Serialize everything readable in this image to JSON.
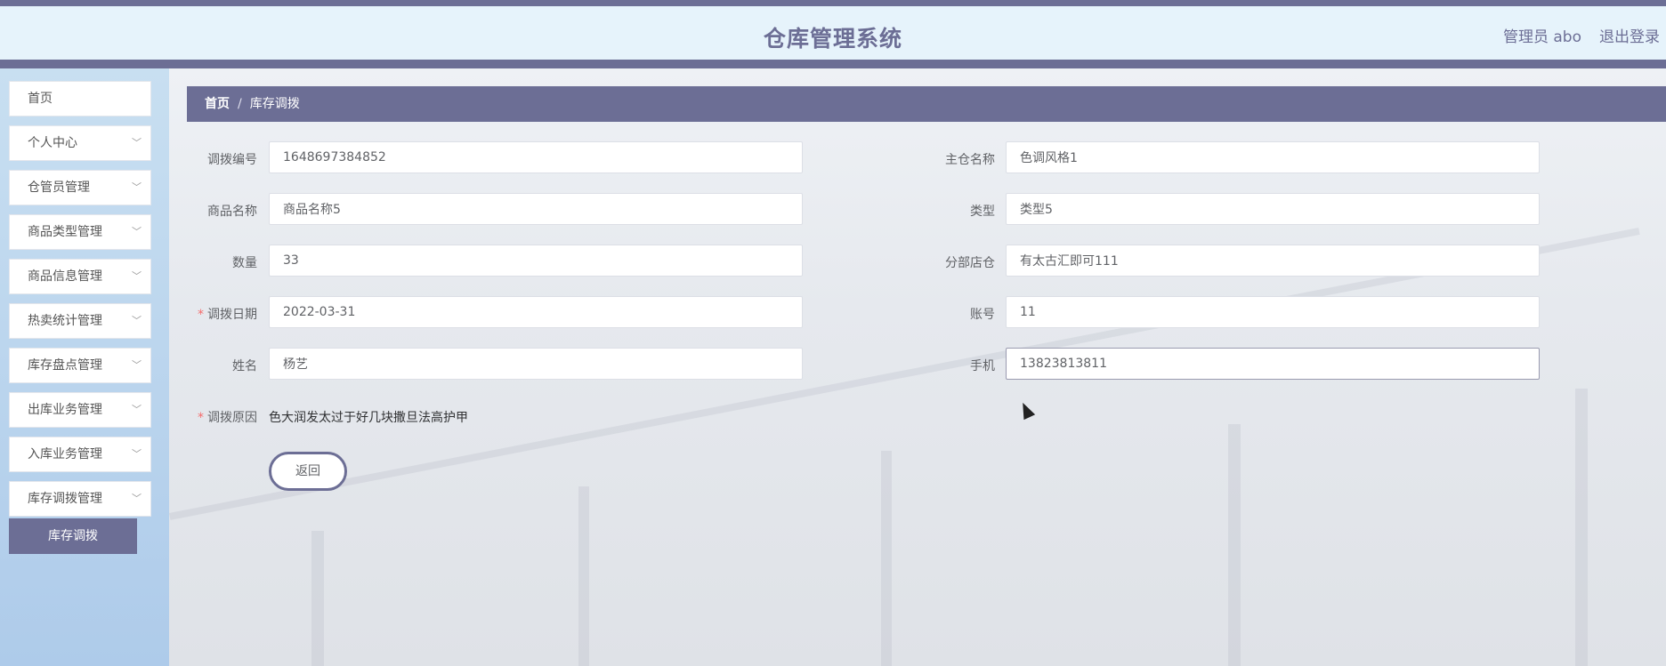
{
  "header": {
    "title": "仓库管理系统",
    "user": "管理员 abo",
    "logout": "退出登录"
  },
  "sidebar": {
    "items": [
      {
        "label": "首页",
        "expandable": false
      },
      {
        "label": "个人中心",
        "expandable": true
      },
      {
        "label": "仓管员管理",
        "expandable": true
      },
      {
        "label": "商品类型管理",
        "expandable": true
      },
      {
        "label": "商品信息管理",
        "expandable": true
      },
      {
        "label": "热卖统计管理",
        "expandable": true
      },
      {
        "label": "库存盘点管理",
        "expandable": true
      },
      {
        "label": "出库业务管理",
        "expandable": true
      },
      {
        "label": "入库业务管理",
        "expandable": true
      },
      {
        "label": "库存调拨管理",
        "expandable": true
      }
    ],
    "active_sub_item": "库存调拨"
  },
  "breadcrumb": {
    "home": "首页",
    "separator": "/",
    "current": "库存调拨"
  },
  "form": {
    "transfer_no": {
      "label": "调拨编号",
      "value": "1648697384852"
    },
    "main_warehouse": {
      "label": "主仓名称",
      "value": "色调风格1"
    },
    "product_name": {
      "label": "商品名称",
      "value": "商品名称5"
    },
    "type": {
      "label": "类型",
      "value": "类型5"
    },
    "quantity": {
      "label": "数量",
      "value": "33"
    },
    "branch_warehouse": {
      "label": "分部店仓",
      "value": "有太古汇即可111"
    },
    "transfer_date": {
      "label": "调拨日期",
      "value": "2022-03-31",
      "required": true
    },
    "account": {
      "label": "账号",
      "value": "11"
    },
    "name": {
      "label": "姓名",
      "value": "杨艺"
    },
    "phone": {
      "label": "手机",
      "value": "13823813811"
    },
    "reason": {
      "label": "调拨原因",
      "value": "色大润发太过于好几块撒旦法高护甲",
      "required": true
    },
    "required_mark": "*",
    "back_button": "返回"
  },
  "colors": {
    "accent": "#6c6e95",
    "header_bg": "#e6f3fb",
    "sidebar_bg": "#aecbea",
    "required": "#f56c6c"
  },
  "icons": {
    "menu_expand": "chevron-down-icon"
  }
}
